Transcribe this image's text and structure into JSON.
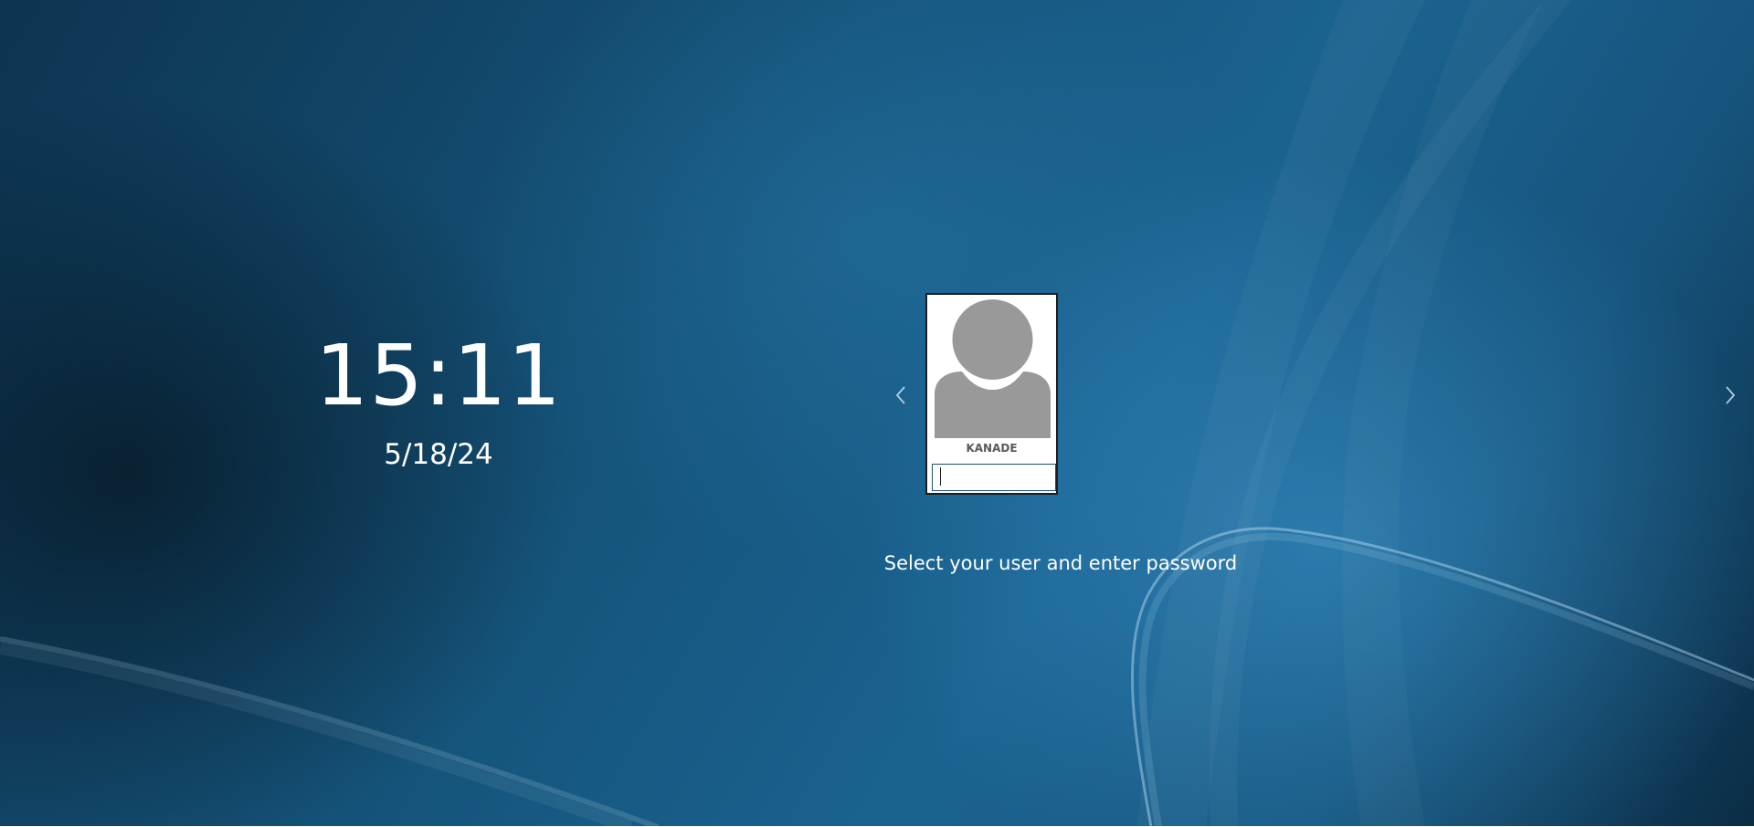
{
  "lock_screen": {
    "clock": {
      "time": "15:11",
      "date": "5/18/24"
    },
    "user_selector": {
      "previous_icon": "chevron-left-icon",
      "next_icon": "chevron-right-icon",
      "user": {
        "name": "KANADE",
        "avatar_icon": "user-silhouette-icon",
        "password_value": ""
      }
    },
    "prompt": "Select your user and enter password"
  },
  "colors": {
    "text": "#ffffff",
    "card_background": "#ffffff",
    "card_border": "#1d1d1d",
    "avatar_gray": "#999999",
    "username_text": "#5a5a5a",
    "input_border": "#1e4f78"
  }
}
